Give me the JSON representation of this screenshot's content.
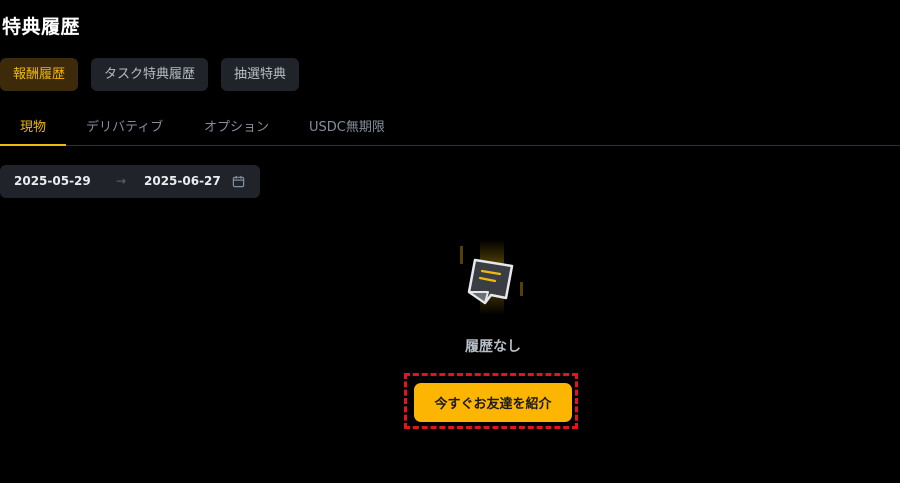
{
  "page": {
    "title": "特典履歴"
  },
  "categories": [
    {
      "label": "報酬履歴",
      "active": true
    },
    {
      "label": "タスク特典履歴",
      "active": false
    },
    {
      "label": "抽選特典",
      "active": false
    }
  ],
  "tabs": [
    {
      "label": "現物",
      "active": true
    },
    {
      "label": "デリバティブ",
      "active": false
    },
    {
      "label": "オプション",
      "active": false
    },
    {
      "label": "USDC無期限",
      "active": false
    }
  ],
  "date_range": {
    "start": "2025-05-29",
    "separator": "→",
    "end": "2025-06-27",
    "icon": "calendar-icon"
  },
  "empty_state": {
    "icon": "empty-document-icon",
    "message": "履歴なし"
  },
  "cta": {
    "label": "今すぐお友達を紹介"
  },
  "colors": {
    "accent": "#f0b90b",
    "button": "#fcb501",
    "highlight": "#e0161b",
    "background": "#000000",
    "surface": "#202329"
  }
}
